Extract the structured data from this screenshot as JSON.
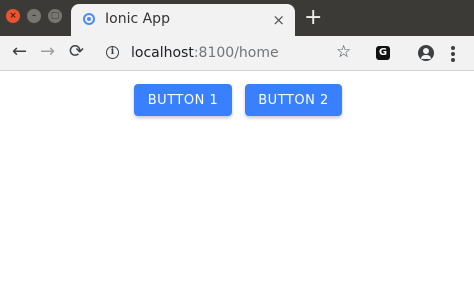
{
  "browser": {
    "tab": {
      "title": "Ionic App",
      "close_glyph": "×"
    },
    "new_tab_glyph": "+",
    "window_controls": {
      "close": "×",
      "minimize": "–",
      "maximize": "□"
    },
    "address": {
      "host": "localhost",
      "path": ":8100/home"
    },
    "icons": {
      "back": "back-arrow-icon",
      "forward": "forward-arrow-icon",
      "reload": "reload-icon",
      "info": "info-icon",
      "bookmark": "star-icon",
      "extension": "extension-icon",
      "profile": "profile-icon",
      "menu": "more-vertical-icon"
    }
  },
  "page": {
    "buttons": [
      {
        "label": "BUTTON 1"
      },
      {
        "label": "BUTTON 2"
      }
    ]
  },
  "colors": {
    "primary": "#3880ff",
    "titlebar": "#3b3a36",
    "toolbar": "#f2f2f2"
  }
}
